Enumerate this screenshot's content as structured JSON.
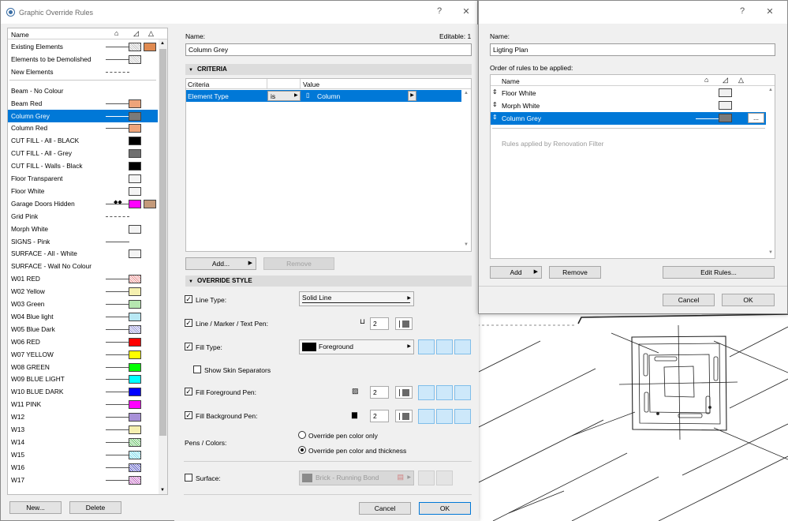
{
  "dialog1": {
    "title": "Graphic Override Rules",
    "help_btn": "?",
    "close_btn": "✕",
    "list_header": "Name",
    "rules": [
      {
        "name": "Existing Elements",
        "line": "solid",
        "sw1": "#bfbfbf",
        "hatch1": true,
        "sw2": "#e08a50"
      },
      {
        "name": "Elements to be Demolished",
        "line": "solid",
        "sw1": "#c8c8c8",
        "hatch1": true
      },
      {
        "name": "New Elements",
        "line": "dash"
      },
      {
        "name": "Beam - No Colour",
        "line": "none"
      },
      {
        "name": "Beam Red",
        "line": "solid",
        "sw1": "#eea47a"
      },
      {
        "name": "Column Grey",
        "line": "solid",
        "sw1": "#7a7a7a",
        "selected": true
      },
      {
        "name": "Column Red",
        "line": "solid",
        "sw1": "#eea47a"
      },
      {
        "name": "CUT FILL - All - BLACK",
        "line": "none",
        "sw1": "#000000"
      },
      {
        "name": "CUT FILL - All - Grey",
        "line": "none",
        "sw1": "#707070"
      },
      {
        "name": "CUT FILL - Walls - Black",
        "line": "none",
        "sw1": "#000000"
      },
      {
        "name": "Floor Transparent",
        "line": "none",
        "sw1": "#f4f4f4"
      },
      {
        "name": "Floor White",
        "line": "none",
        "sw1": "#f4f4f4"
      },
      {
        "name": "Garage Doors Hidden",
        "line": "diamond",
        "sw1": "#ff00ff",
        "sw2": "#c49a7a"
      },
      {
        "name": "Grid Pink",
        "line": "dash"
      },
      {
        "name": "Morph White",
        "line": "none",
        "sw1": "#f4f4f4"
      },
      {
        "name": "SIGNS - Pink",
        "line": "solid"
      },
      {
        "name": "SURFACE - All - White",
        "line": "none",
        "sw1": "#f4f4f4"
      },
      {
        "name": "SURFACE - Wall No Colour",
        "line": "none"
      },
      {
        "name": "W01 RED",
        "line": "solid",
        "sw1": "#e88a8a",
        "hatch1": true
      },
      {
        "name": "W02 Yellow",
        "line": "solid",
        "sw1": "#f5f0b0"
      },
      {
        "name": "W03 Green",
        "line": "solid",
        "sw1": "#b6e6b0"
      },
      {
        "name": "W04 Blue light",
        "line": "solid",
        "sw1": "#b8e8f4"
      },
      {
        "name": "W05 Blue Dark",
        "line": "solid",
        "sw1": "#9090d8",
        "hatch1": true
      },
      {
        "name": "W06 RED",
        "line": "solid",
        "sw1": "#ff0000"
      },
      {
        "name": "W07 YELLOW",
        "line": "solid",
        "sw1": "#ffff00"
      },
      {
        "name": "W08 GREEN",
        "line": "solid",
        "sw1": "#00ff00"
      },
      {
        "name": "W09 BLUE LIGHT",
        "line": "solid",
        "sw1": "#00ffff"
      },
      {
        "name": "W10 BLUE DARK",
        "line": "solid",
        "sw1": "#0000ff"
      },
      {
        "name": "W11 PINK",
        "line": "solid",
        "sw1": "#ff00ff"
      },
      {
        "name": "W12",
        "line": "solid",
        "sw1": "#a890d8"
      },
      {
        "name": "W13",
        "line": "solid",
        "sw1": "#f5f0b0"
      },
      {
        "name": "W14",
        "line": "solid",
        "sw1": "#60c060",
        "hatch1": true
      },
      {
        "name": "W15",
        "line": "solid",
        "sw1": "#70d8e8",
        "hatch1": true
      },
      {
        "name": "W16",
        "line": "solid",
        "sw1": "#5050c0",
        "hatch1": true
      },
      {
        "name": "W17",
        "line": "solid",
        "sw1": "#c060c0",
        "hatch1": true
      }
    ],
    "new_btn": "New...",
    "delete_btn": "Delete",
    "name_label": "Name:",
    "editable_label": "Editable: 1",
    "name_value": "Column Grey",
    "criteria_section": "CRITERIA",
    "criteria_cols": [
      "Criteria",
      "Value"
    ],
    "criteria_row": {
      "criteria": "Element Type",
      "operator": "is",
      "value": "Column"
    },
    "add_btn": "Add...",
    "remove_btn": "Remove",
    "override_section": "OVERRIDE STYLE",
    "line_type_label": "Line Type:",
    "line_type_value": "Solid Line",
    "line_pen_label": "Line / Marker / Text Pen:",
    "line_pen_value": "2",
    "fill_type_label": "Fill Type:",
    "fill_type_value": "Foreground",
    "show_skin_label": "Show Skin Separators",
    "fill_fg_label": "Fill Foreground Pen:",
    "fill_fg_value": "2",
    "fill_bg_label": "Fill Background Pen:",
    "fill_bg_value": "2",
    "pens_colors_label": "Pens / Colors:",
    "radio1": "Override pen color only",
    "radio2": "Override pen color and thickness",
    "surface_label": "Surface:",
    "surface_value": "Brick - Running Bond",
    "cancel_btn": "Cancel",
    "ok_btn": "OK"
  },
  "dialog2": {
    "help_btn": "?",
    "close_btn": "✕",
    "name_label": "Name:",
    "name_value": "Ligting Plan",
    "order_label": "Order of rules to be applied:",
    "list_header": "Name",
    "rules": [
      {
        "name": "Floor White",
        "sw": "#f0f0f0"
      },
      {
        "name": "Morph White",
        "sw": "#f0f0f0"
      },
      {
        "name": "Column Grey",
        "sw": "#7a7a7a",
        "selected": true
      }
    ],
    "more_btn": "...",
    "renovation_text": "Rules applied by Renovation Filter",
    "add_btn": "Add",
    "remove_btn": "Remove",
    "edit_rules_btn": "Edit Rules...",
    "cancel_btn": "Cancel",
    "ok_btn": "OK"
  }
}
